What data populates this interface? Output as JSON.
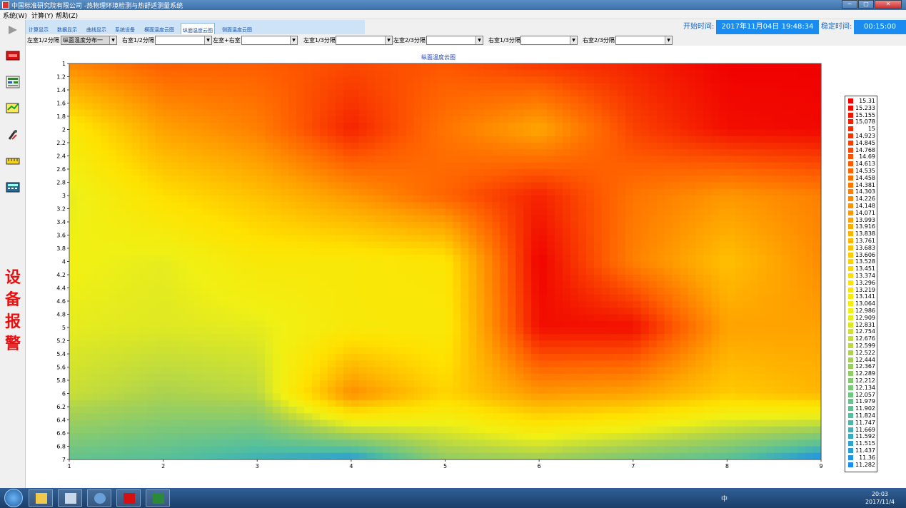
{
  "window": {
    "title": "中国标准研究院有限公司 -热物理环境检测与热舒适测量系统",
    "buttons": [
      "─",
      "□",
      "✕"
    ]
  },
  "menu": [
    "系统(W)",
    "计算(Y)",
    "帮助(Z)"
  ],
  "tabs": [
    "计算显示",
    "数据显示",
    "曲线显示",
    "系统设备",
    "横面温度云图",
    "纵面温度云图",
    "侧面温度云图"
  ],
  "active_tab": "纵面温度云图",
  "start_time": {
    "label": "开始时间:",
    "value": "2017年11月04日 19:48:34"
  },
  "stable_time": {
    "label": "稳定时间:",
    "value": "00:15:00"
  },
  "selectors": [
    {
      "label": "左室1/2分隔",
      "value": "纵面温度分布一"
    },
    {
      "label": "右室1/2分隔",
      "value": ""
    },
    {
      "label": "左室+右室",
      "value": ""
    },
    {
      "label": "左室1/3分隔",
      "value": ""
    },
    {
      "label": "左室2/3分隔",
      "value": ""
    },
    {
      "label": "右室1/3分隔",
      "value": ""
    },
    {
      "label": "右室2/3分隔",
      "value": ""
    }
  ],
  "alarm_text": [
    "设",
    "备",
    "报",
    "警"
  ],
  "sidebar_icons": [
    "play-icon",
    "alarm-meter-icon",
    "data-table-icon",
    "chart-edit-icon",
    "tools-icon",
    "ruler-icon",
    "calculator-icon"
  ],
  "chart_data": {
    "type": "heatmap",
    "title": "纵面温度云图",
    "x": [
      1,
      2,
      3,
      4,
      5,
      6,
      7,
      8,
      9
    ],
    "y": [
      1,
      2,
      3,
      4,
      5,
      6,
      7
    ],
    "x_ticks": [
      "1",
      "2",
      "3",
      "4",
      "5",
      "6",
      "7",
      "8",
      "9"
    ],
    "y_ticks": [
      "1",
      "1.2",
      "1.4",
      "1.6",
      "1.8",
      "2",
      "2.2",
      "2.4",
      "2.6",
      "2.8",
      "3",
      "3.2",
      "3.4",
      "3.6",
      "3.8",
      "4",
      "4.2",
      "4.4",
      "4.6",
      "4.8",
      "5",
      "5.2",
      "5.4",
      "5.6",
      "5.8",
      "6",
      "6.2",
      "6.4",
      "6.6",
      "6.8",
      "7"
    ],
    "y_axis": "inverted",
    "z": [
      [
        14.25,
        14.6,
        14.6,
        14.75,
        14.65,
        14.9,
        15.05,
        15.3,
        15.3
      ],
      [
        13.2,
        14.0,
        14.3,
        15.05,
        14.4,
        13.95,
        14.8,
        15.2,
        15.25
      ],
      [
        12.9,
        13.4,
        13.7,
        14.1,
        14.55,
        15.05,
        14.4,
        14.1,
        14.3
      ],
      [
        13.0,
        12.9,
        13.2,
        13.2,
        13.3,
        15.3,
        14.3,
        13.7,
        14.2
      ],
      [
        12.9,
        12.85,
        12.9,
        13.2,
        13.2,
        15.2,
        15.2,
        14.0,
        14.0
      ],
      [
        12.7,
        12.5,
        12.6,
        14.2,
        13.5,
        14.1,
        14.0,
        13.6,
        13.8
      ],
      [
        11.95,
        11.85,
        11.65,
        11.4,
        12.3,
        12.4,
        12.1,
        11.85,
        11.28
      ]
    ],
    "zmin": 11.282,
    "zmax": 15.31,
    "colorscale": "blue-green-yellow-orange-red",
    "legend_position": "right",
    "legend_values": [
      "15.31",
      "15.233",
      "15.155",
      "15.078",
      "15",
      "14.923",
      "14.845",
      "14.768",
      "14.69",
      "14.613",
      "14.535",
      "14.458",
      "14.381",
      "14.303",
      "14.226",
      "14.148",
      "14.071",
      "13.993",
      "13.916",
      "13.838",
      "13.761",
      "13.683",
      "13.606",
      "13.528",
      "13.451",
      "13.374",
      "13.296",
      "13.219",
      "13.141",
      "13.064",
      "12.986",
      "12.909",
      "12.831",
      "12.754",
      "12.676",
      "12.599",
      "12.522",
      "12.444",
      "12.367",
      "12.289",
      "12.212",
      "12.134",
      "12.057",
      "11.979",
      "11.902",
      "11.824",
      "11.747",
      "11.669",
      "11.592",
      "11.515",
      "11.437",
      "11.36",
      "11.282"
    ]
  },
  "taskbar": {
    "tray_text": "中",
    "clock_time": "20:03",
    "clock_date": "2017/11/4"
  }
}
